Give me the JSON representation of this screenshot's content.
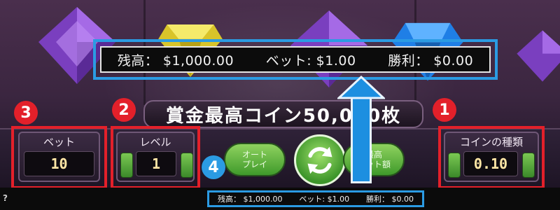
{
  "balance_bar": {
    "balance": "残高： $1,000.00",
    "bet": "ベット: $1.00",
    "win": "勝利： $0.00"
  },
  "status_bar": {
    "balance": "残高： $1,000.00",
    "bet": "ベット: $1.00",
    "win": "勝利： $0.00",
    "help": "?"
  },
  "jackpot_banner": "賞金最高コイン50,000枚",
  "controls": {
    "bet": {
      "label": "ベット",
      "value": "10"
    },
    "level": {
      "label": "レベル",
      "value": "1"
    },
    "coin_type": {
      "label": "コインの種類",
      "value": "0.10"
    },
    "autoplay_label": "オート\nプレイ",
    "max_bet_label": "最高\nベット額"
  },
  "annotations": {
    "badge_1": "1",
    "badge_2": "2",
    "badge_3": "3",
    "badge_4": "4"
  },
  "colors": {
    "highlight_red": "#e3202a",
    "highlight_blue": "#2b9be3",
    "button_green": "#5fb040"
  },
  "icons": {
    "spin": "refresh-icon"
  }
}
